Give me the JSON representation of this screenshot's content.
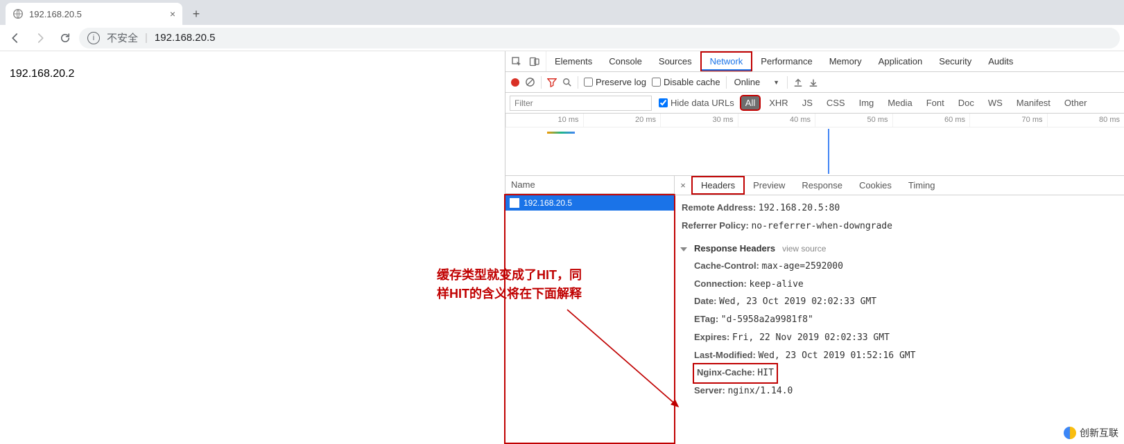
{
  "browser": {
    "tab_title": "192.168.20.5",
    "new_tab_icon": "+",
    "close_icon": "×",
    "nav": {
      "back": "←",
      "forward": "→",
      "reload": "↻"
    },
    "omnibox": {
      "unsafe_label": "不安全",
      "separator": "|",
      "url": "192.168.20.5"
    }
  },
  "page": {
    "body_text": "192.168.20.2",
    "annotation_line1": "缓存类型就变成了HIT，同",
    "annotation_line2": "样HIT的含义将在下面解释",
    "watermark": "创新互联"
  },
  "devtools": {
    "tabs": [
      "Elements",
      "Console",
      "Sources",
      "Network",
      "Performance",
      "Memory",
      "Application",
      "Security",
      "Audits"
    ],
    "active_tab": "Network",
    "toolbar": {
      "preserve_log": "Preserve log",
      "disable_cache": "Disable cache",
      "online": "Online"
    },
    "filter": {
      "placeholder": "Filter",
      "hide_data_urls": "Hide data URLs",
      "pills": [
        "All",
        "XHR",
        "JS",
        "CSS",
        "Img",
        "Media",
        "Font",
        "Doc",
        "WS",
        "Manifest",
        "Other"
      ],
      "active_pill": "All"
    },
    "timeline_ticks": [
      "10 ms",
      "20 ms",
      "30 ms",
      "40 ms",
      "50 ms",
      "60 ms",
      "70 ms",
      "80 ms"
    ],
    "request_list": {
      "header": "Name",
      "items": [
        "192.168.20.5"
      ]
    },
    "detail_tabs": [
      "Headers",
      "Preview",
      "Response",
      "Cookies",
      "Timing"
    ],
    "active_detail_tab": "Headers",
    "detail": {
      "remote_address_k": "Remote Address:",
      "remote_address_v": "192.168.20.5:80",
      "referrer_policy_k": "Referrer Policy:",
      "referrer_policy_v": "no-referrer-when-downgrade",
      "section_response_headers": "Response Headers",
      "view_source": "view source",
      "rows": [
        {
          "k": "Cache-Control:",
          "v": "max-age=2592000"
        },
        {
          "k": "Connection:",
          "v": "keep-alive"
        },
        {
          "k": "Date:",
          "v": "Wed, 23 Oct 2019 02:02:33 GMT"
        },
        {
          "k": "ETag:",
          "v": "\"d-5958a2a9981f8\""
        },
        {
          "k": "Expires:",
          "v": "Fri, 22 Nov 2019 02:02:33 GMT"
        },
        {
          "k": "Last-Modified:",
          "v": "Wed, 23 Oct 2019 01:52:16 GMT"
        },
        {
          "k": "Nginx-Cache:",
          "v": "HIT"
        },
        {
          "k": "Server:",
          "v": "nginx/1.14.0"
        }
      ],
      "highlight_row_key": "Nginx-Cache:"
    }
  }
}
